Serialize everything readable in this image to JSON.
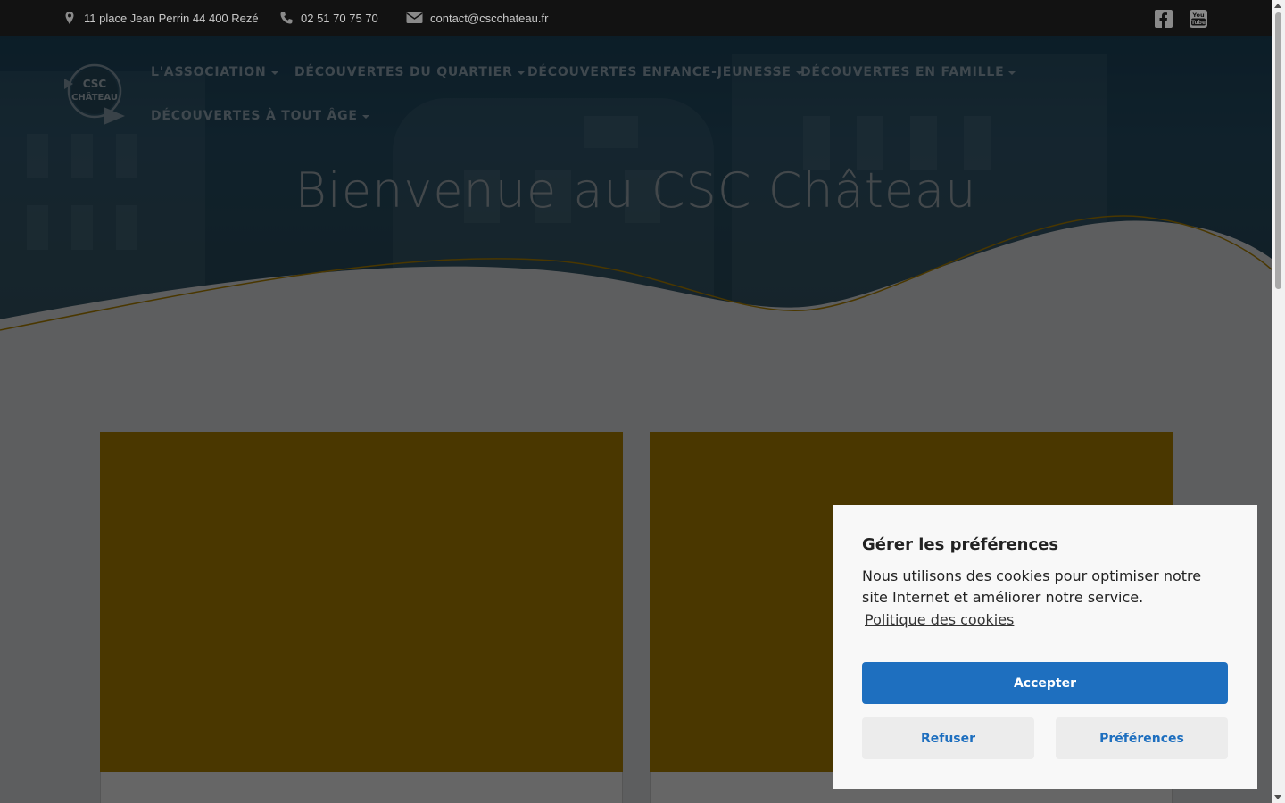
{
  "topbar": {
    "address": "11 place Jean Perrin 44 400 Rezé",
    "phone": "02 51 70 75 70",
    "email": "contact@cscchateau.fr",
    "social": [
      "facebook-icon",
      "youtube-icon"
    ]
  },
  "logo": {
    "line1": "CSC",
    "line2": "CHÂTEAU"
  },
  "nav": {
    "items": [
      {
        "label": "L'ASSOCIATION"
      },
      {
        "label": "DÉCOUVERTES DU QUARTIER"
      },
      {
        "label": "DÉCOUVERTES ENFANCE-JEUNESSE"
      },
      {
        "label": "DÉCOUVERTES EN FAMILLE"
      },
      {
        "label": "DÉCOUVERTES À TOUT ÂGE"
      }
    ]
  },
  "hero": {
    "title": "Bienvenue au CSC Château"
  },
  "colors": {
    "accent_gold": "#b98a00",
    "button_blue": "#1e6fbf",
    "topbar_bg": "#121212",
    "hero_blue": "#1f4a63"
  },
  "cookie": {
    "title": "Gérer les préférences",
    "text": "Nous utilisons des cookies pour optimiser notre site Internet et améliorer notre service.",
    "policy_link": "Politique des cookies",
    "accept_label": "Accepter",
    "refuse_label": "Refuser",
    "prefs_label": "Préférences"
  }
}
